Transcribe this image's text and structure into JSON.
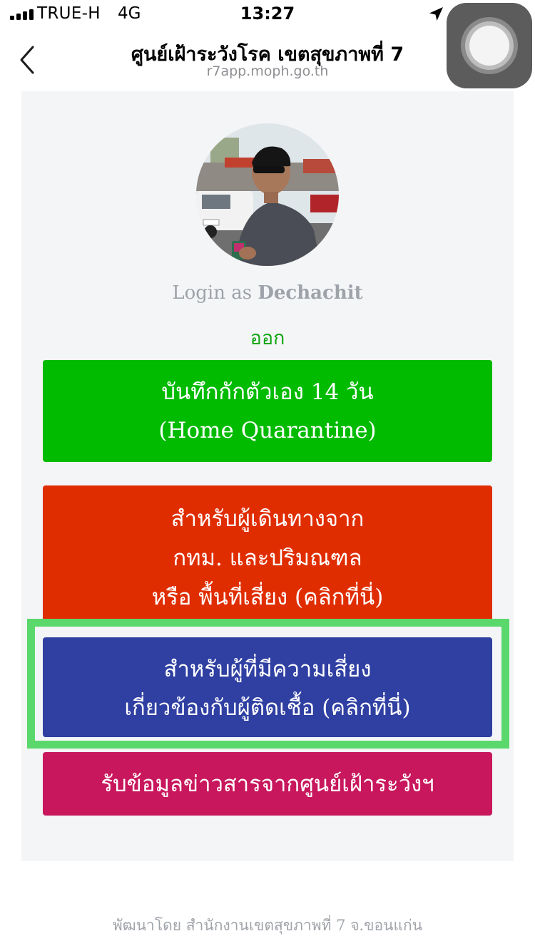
{
  "status_bar": {
    "carrier": "TRUE-H",
    "network": "4G",
    "time": "13:27",
    "signal_bars": 4
  },
  "header": {
    "title": "ศูนย์เฝ้าระวังโรค เขตสุขภาพที่ 7",
    "url": "r7app.moph.go.th"
  },
  "profile": {
    "login_prefix": "Login as",
    "username": "Dechachit",
    "logout_label": "ออก"
  },
  "buttons": {
    "home_quarantine": {
      "line1": "บันทึกกักตัวเอง 14 วัน",
      "line2": "(Home Quarantine)",
      "color": "#00bb00"
    },
    "travelers": {
      "line1": "สำหรับผู้เดินทางจาก",
      "line2": "กทม. และปริมณฑล",
      "line3": "หรือ พื้นที่เสี่ยง (คลิกที่นี่)",
      "color": "#e02d00"
    },
    "risk_contacts": {
      "line1": "สำหรับผู้ที่มีความเสี่ยง",
      "line2": "เกี่ยวข้องกับผู้ติดเชื้อ (คลิกที่นี่)",
      "color": "#2f3fa2"
    },
    "news": {
      "label": "รับข้อมูลข่าวสารจากศูนย์เฝ้าระวังฯ",
      "color": "#c8175c"
    }
  },
  "highlight_color": "#5bd86c",
  "footer": {
    "credit": "พัฒนาโดย สำนักงานเขตสุขภาพที่ 7 จ.ขอนแก่น"
  },
  "icons": {
    "back": "chevron-left-icon",
    "location": "location-arrow-icon",
    "assistive": "assistive-touch-icon"
  }
}
